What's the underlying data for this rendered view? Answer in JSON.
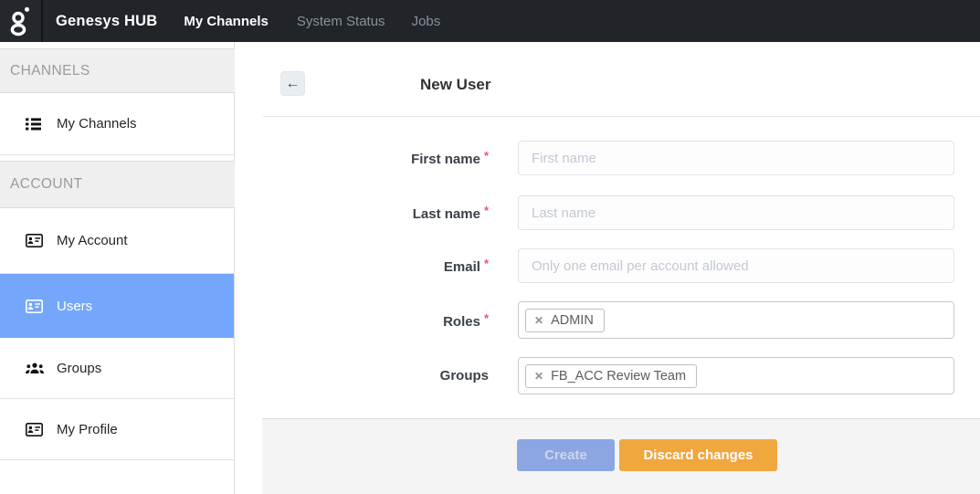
{
  "navbar": {
    "brand": "Genesys HUB",
    "items": [
      {
        "label": "My Channels",
        "active": true
      },
      {
        "label": "System Status",
        "active": false
      },
      {
        "label": "Jobs",
        "active": false
      }
    ]
  },
  "sidebar": {
    "sections": [
      {
        "header": "CHANNELS",
        "items": [
          {
            "label": "My Channels",
            "icon": "list-icon",
            "selected": false
          }
        ]
      },
      {
        "header": "ACCOUNT",
        "items": [
          {
            "label": "My Account",
            "icon": "contact-card-icon",
            "selected": false
          },
          {
            "label": "Users",
            "icon": "contact-card-icon",
            "selected": true
          },
          {
            "label": "Groups",
            "icon": "people-icon",
            "selected": false
          },
          {
            "label": "My Profile",
            "icon": "contact-card-icon",
            "selected": false
          }
        ]
      }
    ]
  },
  "content": {
    "title": "New User",
    "back_icon": "←",
    "form": {
      "required_marker": "*",
      "tag_remove_icon": "✕",
      "fields": [
        {
          "label": "First name",
          "required": true,
          "type": "text",
          "value": "",
          "placeholder": "First name"
        },
        {
          "label": "Last name",
          "required": true,
          "type": "text",
          "value": "",
          "placeholder": "Last name"
        },
        {
          "label": "Email",
          "required": true,
          "type": "text",
          "value": "",
          "placeholder": "Only one email per account allowed"
        },
        {
          "label": "Roles",
          "required": true,
          "type": "tags",
          "tags": [
            "ADMIN"
          ]
        },
        {
          "label": "Groups",
          "required": false,
          "type": "tags",
          "tags": [
            "FB_ACC Review Team"
          ]
        }
      ]
    },
    "footer": {
      "create_label": "Create",
      "discard_label": "Discard changes"
    }
  },
  "colors": {
    "navbar_bg": "#212529",
    "selected_item_bg": "#74a7fb",
    "create_button_bg": "#8ba6e2",
    "discard_button_bg": "#efa73e",
    "required_asterisk": "#e8546f",
    "footer_bg": "#f4f4f4"
  }
}
